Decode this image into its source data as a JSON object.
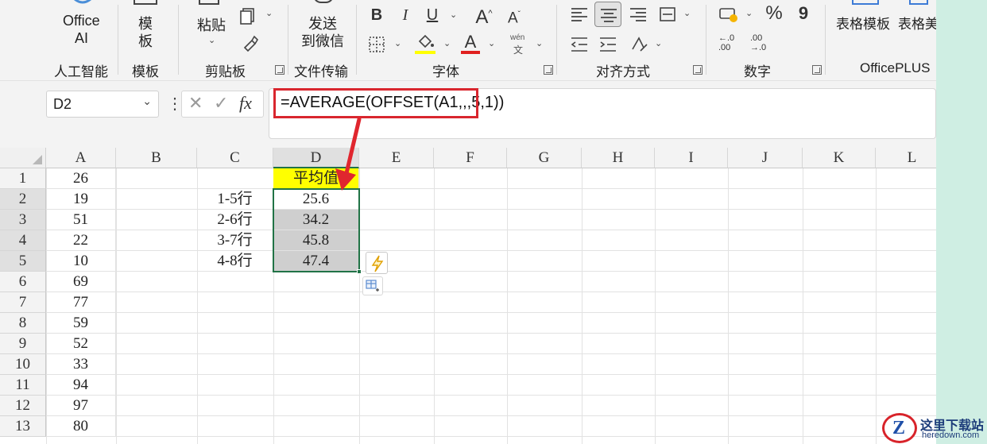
{
  "ribbon": {
    "office_ai": {
      "line1": "Office",
      "line2": "AI",
      "group": "人工智能"
    },
    "template": {
      "line1": "模",
      "line2": "板",
      "group": "模板"
    },
    "clipboard": {
      "paste": "粘贴",
      "group": "剪贴板"
    },
    "transfer": {
      "line1": "发送",
      "line2": "到微信",
      "group": "文件传输"
    },
    "font": {
      "bold": "B",
      "italic": "I",
      "underline": "U",
      "grow": "A",
      "shrink": "A",
      "font_color": "A",
      "phonetic_top": "wén",
      "phonetic_bottom": "文",
      "group": "字体"
    },
    "alignment": {
      "group": "对齐方式"
    },
    "number": {
      "percent": "%",
      "comma": "9",
      "inc_decimals": "←.0\n.00",
      "dec_decimals": ".00\n→.0",
      "group": "数字"
    },
    "officeplus": {
      "table_template": "表格模板",
      "table_beauty": "表格美",
      "group": "OfficePLUS"
    }
  },
  "formula_bar": {
    "name_box": "D2",
    "fx": "fx",
    "formula": "=AVERAGE(OFFSET(A1,,,5,1))"
  },
  "sheet": {
    "columns": [
      "A",
      "B",
      "C",
      "D",
      "E",
      "F",
      "G",
      "H",
      "I",
      "J",
      "K",
      "L"
    ],
    "rows": [
      "1",
      "2",
      "3",
      "4",
      "5",
      "6",
      "7",
      "8",
      "9",
      "10",
      "11",
      "12",
      "13"
    ],
    "col_a": [
      "26",
      "19",
      "51",
      "22",
      "10",
      "69",
      "77",
      "59",
      "52",
      "33",
      "94",
      "97",
      "80"
    ],
    "col_c": [
      "",
      "1-5行",
      "2-6行",
      "3-7行",
      "4-8行"
    ],
    "col_d": [
      "平均值",
      "25.6",
      "34.2",
      "45.8",
      "47.4"
    ]
  },
  "watermark": {
    "site": "这里下载站",
    "domain": "heredown.com",
    "letter": "Z"
  },
  "colors": {
    "accent_green": "#217346",
    "highlight_red": "#d9262e",
    "header_yellow": "#ffff00",
    "selection_gray": "#cfcfcf"
  }
}
